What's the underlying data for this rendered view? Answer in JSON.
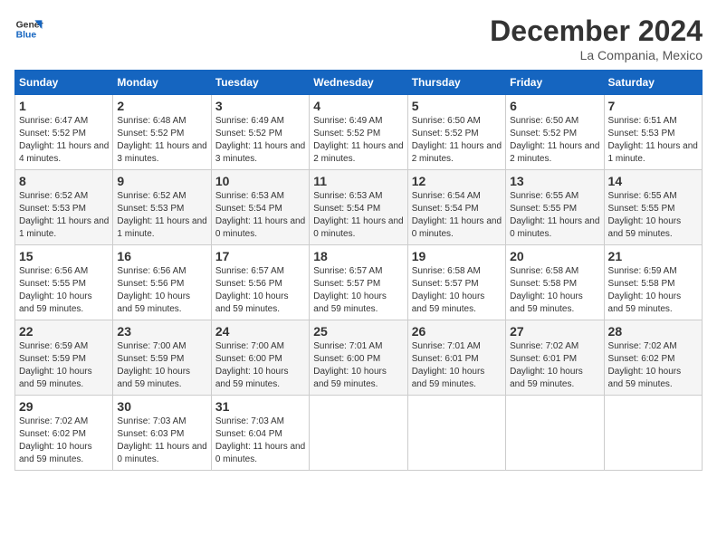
{
  "header": {
    "logo_line1": "General",
    "logo_line2": "Blue",
    "month": "December 2024",
    "location": "La Compania, Mexico"
  },
  "days_of_week": [
    "Sunday",
    "Monday",
    "Tuesday",
    "Wednesday",
    "Thursday",
    "Friday",
    "Saturday"
  ],
  "weeks": [
    [
      {
        "day": "1",
        "sunrise": "6:47 AM",
        "sunset": "5:52 PM",
        "daylight": "11 hours and 4 minutes."
      },
      {
        "day": "2",
        "sunrise": "6:48 AM",
        "sunset": "5:52 PM",
        "daylight": "11 hours and 3 minutes."
      },
      {
        "day": "3",
        "sunrise": "6:49 AM",
        "sunset": "5:52 PM",
        "daylight": "11 hours and 3 minutes."
      },
      {
        "day": "4",
        "sunrise": "6:49 AM",
        "sunset": "5:52 PM",
        "daylight": "11 hours and 2 minutes."
      },
      {
        "day": "5",
        "sunrise": "6:50 AM",
        "sunset": "5:52 PM",
        "daylight": "11 hours and 2 minutes."
      },
      {
        "day": "6",
        "sunrise": "6:50 AM",
        "sunset": "5:52 PM",
        "daylight": "11 hours and 2 minutes."
      },
      {
        "day": "7",
        "sunrise": "6:51 AM",
        "sunset": "5:53 PM",
        "daylight": "11 hours and 1 minute."
      }
    ],
    [
      {
        "day": "8",
        "sunrise": "6:52 AM",
        "sunset": "5:53 PM",
        "daylight": "11 hours and 1 minute."
      },
      {
        "day": "9",
        "sunrise": "6:52 AM",
        "sunset": "5:53 PM",
        "daylight": "11 hours and 1 minute."
      },
      {
        "day": "10",
        "sunrise": "6:53 AM",
        "sunset": "5:54 PM",
        "daylight": "11 hours and 0 minutes."
      },
      {
        "day": "11",
        "sunrise": "6:53 AM",
        "sunset": "5:54 PM",
        "daylight": "11 hours and 0 minutes."
      },
      {
        "day": "12",
        "sunrise": "6:54 AM",
        "sunset": "5:54 PM",
        "daylight": "11 hours and 0 minutes."
      },
      {
        "day": "13",
        "sunrise": "6:55 AM",
        "sunset": "5:55 PM",
        "daylight": "11 hours and 0 minutes."
      },
      {
        "day": "14",
        "sunrise": "6:55 AM",
        "sunset": "5:55 PM",
        "daylight": "10 hours and 59 minutes."
      }
    ],
    [
      {
        "day": "15",
        "sunrise": "6:56 AM",
        "sunset": "5:55 PM",
        "daylight": "10 hours and 59 minutes."
      },
      {
        "day": "16",
        "sunrise": "6:56 AM",
        "sunset": "5:56 PM",
        "daylight": "10 hours and 59 minutes."
      },
      {
        "day": "17",
        "sunrise": "6:57 AM",
        "sunset": "5:56 PM",
        "daylight": "10 hours and 59 minutes."
      },
      {
        "day": "18",
        "sunrise": "6:57 AM",
        "sunset": "5:57 PM",
        "daylight": "10 hours and 59 minutes."
      },
      {
        "day": "19",
        "sunrise": "6:58 AM",
        "sunset": "5:57 PM",
        "daylight": "10 hours and 59 minutes."
      },
      {
        "day": "20",
        "sunrise": "6:58 AM",
        "sunset": "5:58 PM",
        "daylight": "10 hours and 59 minutes."
      },
      {
        "day": "21",
        "sunrise": "6:59 AM",
        "sunset": "5:58 PM",
        "daylight": "10 hours and 59 minutes."
      }
    ],
    [
      {
        "day": "22",
        "sunrise": "6:59 AM",
        "sunset": "5:59 PM",
        "daylight": "10 hours and 59 minutes."
      },
      {
        "day": "23",
        "sunrise": "7:00 AM",
        "sunset": "5:59 PM",
        "daylight": "10 hours and 59 minutes."
      },
      {
        "day": "24",
        "sunrise": "7:00 AM",
        "sunset": "6:00 PM",
        "daylight": "10 hours and 59 minutes."
      },
      {
        "day": "25",
        "sunrise": "7:01 AM",
        "sunset": "6:00 PM",
        "daylight": "10 hours and 59 minutes."
      },
      {
        "day": "26",
        "sunrise": "7:01 AM",
        "sunset": "6:01 PM",
        "daylight": "10 hours and 59 minutes."
      },
      {
        "day": "27",
        "sunrise": "7:02 AM",
        "sunset": "6:01 PM",
        "daylight": "10 hours and 59 minutes."
      },
      {
        "day": "28",
        "sunrise": "7:02 AM",
        "sunset": "6:02 PM",
        "daylight": "10 hours and 59 minutes."
      }
    ],
    [
      {
        "day": "29",
        "sunrise": "7:02 AM",
        "sunset": "6:02 PM",
        "daylight": "10 hours and 59 minutes."
      },
      {
        "day": "30",
        "sunrise": "7:03 AM",
        "sunset": "6:03 PM",
        "daylight": "11 hours and 0 minutes."
      },
      {
        "day": "31",
        "sunrise": "7:03 AM",
        "sunset": "6:04 PM",
        "daylight": "11 hours and 0 minutes."
      },
      null,
      null,
      null,
      null
    ]
  ]
}
